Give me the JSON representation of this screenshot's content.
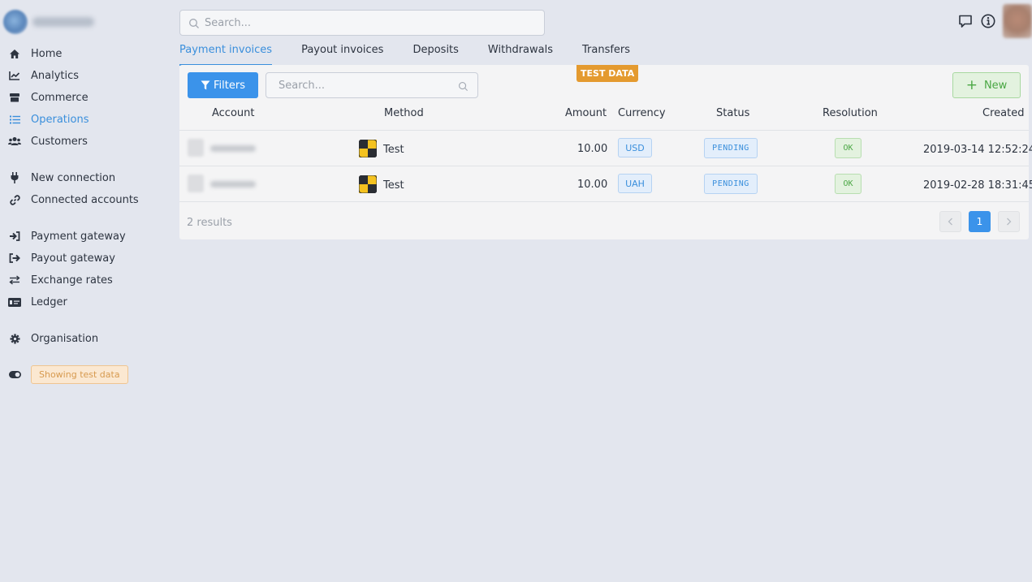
{
  "sidebar": {
    "items": [
      {
        "label": "Home",
        "icon": "home-icon"
      },
      {
        "label": "Analytics",
        "icon": "chart-line-icon"
      },
      {
        "label": "Commerce",
        "icon": "store-icon"
      },
      {
        "label": "Operations",
        "icon": "list-icon"
      },
      {
        "label": "Customers",
        "icon": "users-icon"
      },
      {
        "label": "New connection",
        "icon": "plug-icon"
      },
      {
        "label": "Connected accounts",
        "icon": "link-icon"
      },
      {
        "label": "Payment gateway",
        "icon": "sign-in-icon"
      },
      {
        "label": "Payout gateway",
        "icon": "sign-out-icon"
      },
      {
        "label": "Exchange rates",
        "icon": "exchange-icon"
      },
      {
        "label": "Ledger",
        "icon": "ledger-icon"
      },
      {
        "label": "Organisation",
        "icon": "gear-icon"
      }
    ],
    "test_toggle_label": "Showing test data"
  },
  "search": {
    "placeholder": "Search..."
  },
  "tabs": [
    {
      "label": "Payment invoices"
    },
    {
      "label": "Payout invoices"
    },
    {
      "label": "Deposits"
    },
    {
      "label": "Withdrawals"
    },
    {
      "label": "Transfers"
    }
  ],
  "card": {
    "test_data_label": "TEST DATA",
    "filters_label": "Filters",
    "search_placeholder": "Search...",
    "new_label": "New",
    "columns": {
      "account": "Account",
      "method": "Method",
      "amount": "Amount",
      "currency": "Currency",
      "status": "Status",
      "resolution": "Resolution",
      "created": "Created"
    },
    "rows": [
      {
        "method": "Test",
        "amount": "10.00",
        "currency": "USD",
        "status": "PENDING",
        "resolution": "OK",
        "created": "2019-03-14 12:52:24"
      },
      {
        "method": "Test",
        "amount": "10.00",
        "currency": "UAH",
        "status": "PENDING",
        "resolution": "OK",
        "created": "2019-02-28 18:31:45"
      }
    ],
    "results_text": "2 results",
    "current_page": "1"
  },
  "colors": {
    "accent": "#3b93ea",
    "success": "#4aa744",
    "warning": "#e49a2f",
    "background": "#e3e6ee"
  }
}
